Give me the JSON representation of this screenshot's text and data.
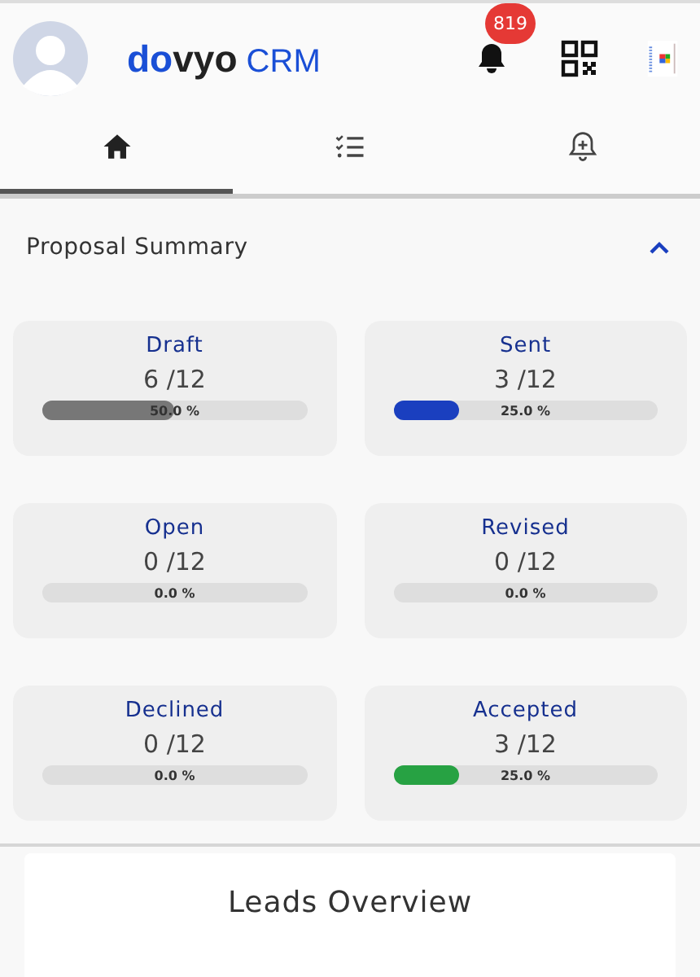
{
  "header": {
    "logo": {
      "first": "do",
      "second": "vyo",
      "suffix": "CRM"
    },
    "notification_count": "819"
  },
  "tabs": [
    {
      "kind": "home",
      "selected": true
    },
    {
      "kind": "tasks",
      "selected": false
    },
    {
      "kind": "reminder",
      "selected": false
    }
  ],
  "proposal_summary": {
    "title": "Proposal Summary",
    "expanded": true,
    "cards": [
      {
        "title": "Draft",
        "count": "6 /12",
        "level": 0.5,
        "reading": "50.0 %",
        "color": "#777777"
      },
      {
        "title": "Sent",
        "count": "3 /12",
        "level": 0.25,
        "reading": "25.0 %",
        "color": "#1a3fbf"
      },
      {
        "title": "Open",
        "count": "0 /12",
        "level": 0,
        "reading": "0.0 %"
      },
      {
        "title": "Revised",
        "count": "0 /12",
        "level": 0,
        "reading": "0.0 %"
      },
      {
        "title": "Declined",
        "count": "0 /12",
        "level": 0,
        "reading": "0.0 %"
      },
      {
        "title": "Accepted",
        "count": "3 /12",
        "level": 0.25,
        "reading": "25.0 %",
        "color": "#27a243"
      }
    ]
  },
  "leads_overview": {
    "title": "Leads Overview"
  }
}
